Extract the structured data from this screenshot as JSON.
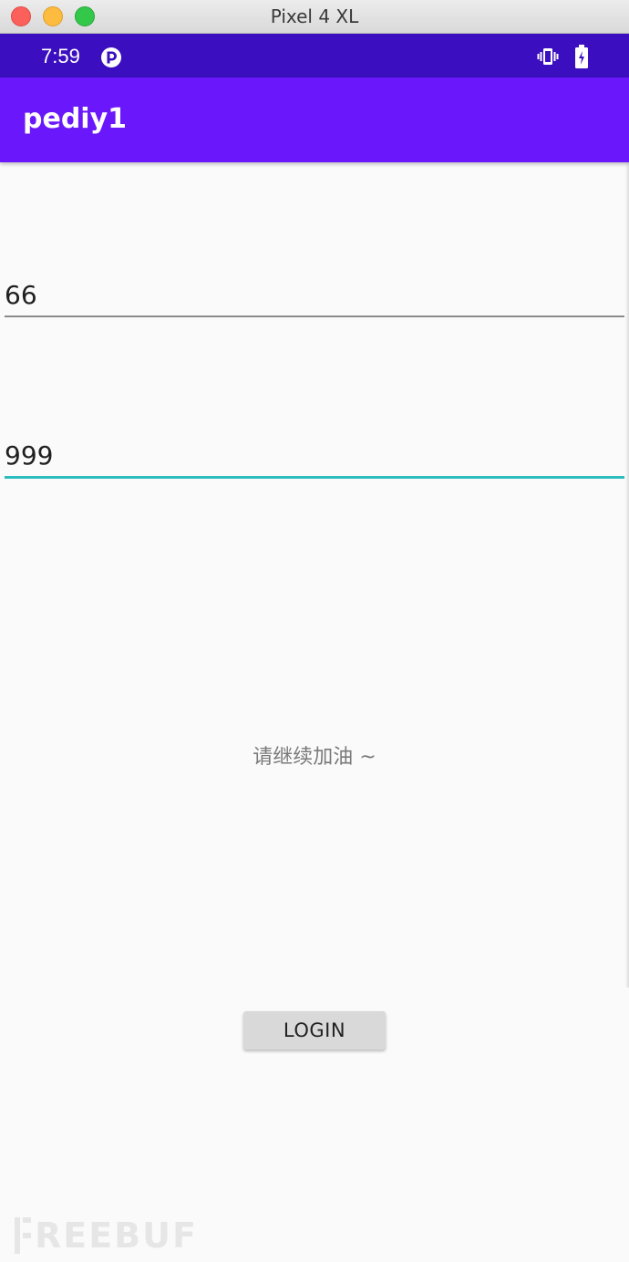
{
  "window": {
    "title": "Pixel 4 XL"
  },
  "statusbar": {
    "time": "7:59",
    "icons": [
      "notification-p-icon",
      "vibrate-icon",
      "battery-charging-icon"
    ]
  },
  "appbar": {
    "title": "pediy1"
  },
  "form": {
    "field1_value": "66",
    "field2_value": "999",
    "message": "请继续加油 ~",
    "login_label": "LOGIN"
  },
  "watermark": {
    "text": "REEBUF"
  },
  "colors": {
    "status_bar": "#3b0fbf",
    "app_bar": "#6a18fb",
    "focused_underline": "#2bbcc0",
    "button_bg": "#d9d9d9"
  }
}
